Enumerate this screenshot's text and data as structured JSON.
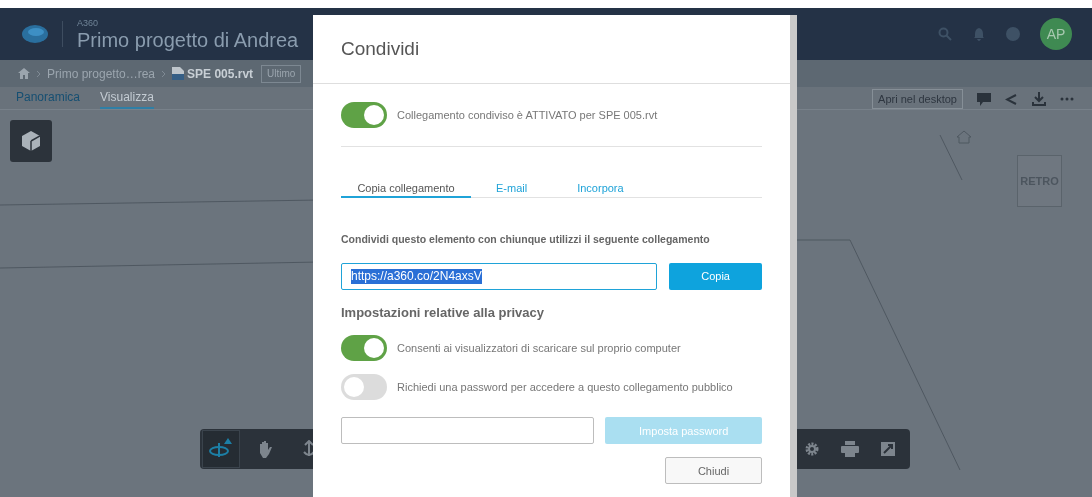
{
  "header": {
    "product": "A360",
    "project_title": "Primo progetto di Andrea",
    "avatar": "AP"
  },
  "breadcrumb": {
    "items": [
      "Primo progetto…rea",
      "SPE 005.rvt"
    ],
    "version": "Ultimo"
  },
  "view_tabs": [
    {
      "label": "Panoramica",
      "selected": false
    },
    {
      "label": "Visualizza",
      "selected": true
    }
  ],
  "viewer": {
    "open_button": "Apri nel desktop",
    "cube_face": "RETRO"
  },
  "toolbar_tools": [
    {
      "kind": "orbit",
      "selected": true
    },
    {
      "kind": "pan",
      "selected": false
    },
    {
      "kind": "dolly",
      "selected": false
    },
    {
      "kind": "settings",
      "selected": false
    },
    {
      "kind": "print",
      "selected": false
    },
    {
      "kind": "fullscreen",
      "selected": false
    }
  ],
  "dialog": {
    "title": "Condividi",
    "share_toggle": {
      "label": "Collegamento condiviso è ATTIVATO per SPE 005.rvt",
      "on": true
    },
    "tabs": [
      {
        "label": "Copia collegamento",
        "selected": true
      },
      {
        "label": "E-mail",
        "selected": false
      },
      {
        "label": "Incorpora",
        "selected": false
      }
    ],
    "description": "Condividi questo elemento con chiunque utilizzi il seguente collegamento",
    "link_value": "https://a360.co/2N4axsV",
    "copy_button": "Copia",
    "privacy_heading": "Impostazioni relative alla privacy",
    "privacy_toggles": [
      {
        "label": "Consenti ai visualizzatori di scaricare sul proprio computer",
        "on": true
      },
      {
        "label": "Richiedi una password per accedere a questo collegamento pubblico",
        "on": false
      }
    ],
    "password_button": {
      "label": "Imposta password",
      "disabled": true
    },
    "close_button": "Chiudi"
  }
}
